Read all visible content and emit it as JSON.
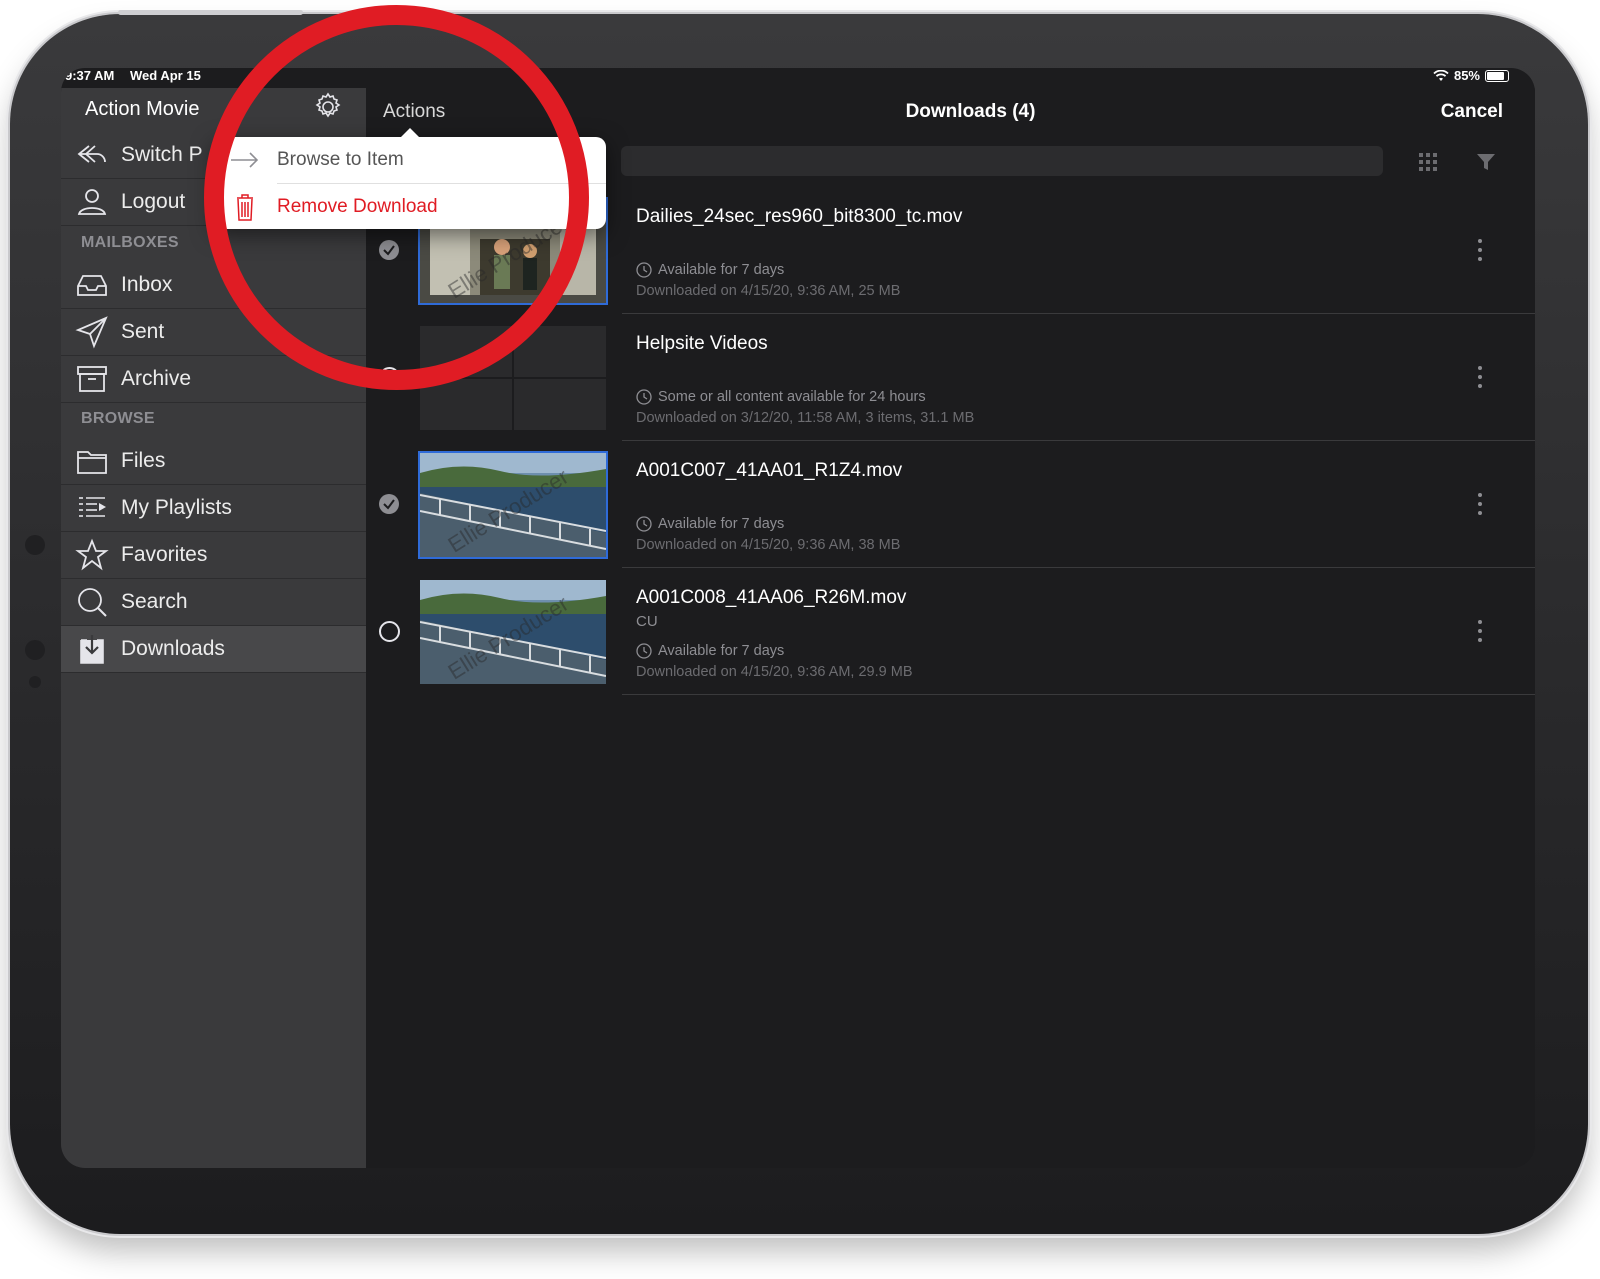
{
  "status_bar": {
    "time": "9:37 AM",
    "date": "Wed Apr 15",
    "battery": "85%"
  },
  "sidebar": {
    "title": "Action Movie",
    "top_items": [
      {
        "label": "Switch P",
        "icon": "switch-icon"
      },
      {
        "label": "Logout",
        "icon": "user-icon"
      }
    ],
    "sections": [
      {
        "title": "MAILBOXES",
        "items": [
          {
            "label": "Inbox",
            "icon": "inbox-icon"
          },
          {
            "label": "Sent",
            "icon": "send-icon"
          },
          {
            "label": "Archive",
            "icon": "archive-icon"
          }
        ]
      },
      {
        "title": "BROWSE",
        "items": [
          {
            "label": "Files",
            "icon": "folder-icon"
          },
          {
            "label": "My Playlists",
            "icon": "playlist-icon"
          },
          {
            "label": "Favorites",
            "icon": "star-icon"
          },
          {
            "label": "Search",
            "icon": "search-icon"
          },
          {
            "label": "Downloads",
            "icon": "download-icon"
          }
        ]
      }
    ]
  },
  "topbar": {
    "actions": "Actions",
    "title": "Downloads (4)",
    "cancel": "Cancel"
  },
  "popover": {
    "items": [
      {
        "label": "Browse to Item",
        "icon": "arrow-right-icon",
        "color": "#333333"
      },
      {
        "label": "Remove Download",
        "icon": "trash-icon",
        "color": "#e01c24"
      }
    ]
  },
  "downloads": [
    {
      "name": "Dailies_24sec_res960_bit8300_tc.mov",
      "subtitle": "",
      "availability": "Available for 7 days",
      "downloaded": "Downloaded on 4/15/20, 9:36 AM, 25 MB",
      "selected": true,
      "watermark": "Ellie Producer"
    },
    {
      "name": "Helpsite Videos",
      "subtitle": "",
      "availability": "Some or all content available for 24 hours",
      "downloaded": "Downloaded on 3/12/20, 11:58 AM, 3 items, 31.1 MB",
      "selected": false,
      "watermark": ""
    },
    {
      "name": "A001C007_41AA01_R1Z4.mov",
      "subtitle": "",
      "availability": "Available for 7 days",
      "downloaded": "Downloaded on 4/15/20, 9:36 AM, 38 MB",
      "selected": true,
      "watermark": "Ellie Producer"
    },
    {
      "name": "A001C008_41AA06_R26M.mov",
      "subtitle": "CU",
      "availability": "Available for 7 days",
      "downloaded": "Downloaded on 4/15/20, 9:36 AM, 29.9 MB",
      "selected": false,
      "watermark": "Ellie Producer"
    }
  ],
  "colors": {
    "highlight_ring": "#e01c24",
    "selection": "#2f6bd8",
    "destructive": "#e01c24"
  }
}
